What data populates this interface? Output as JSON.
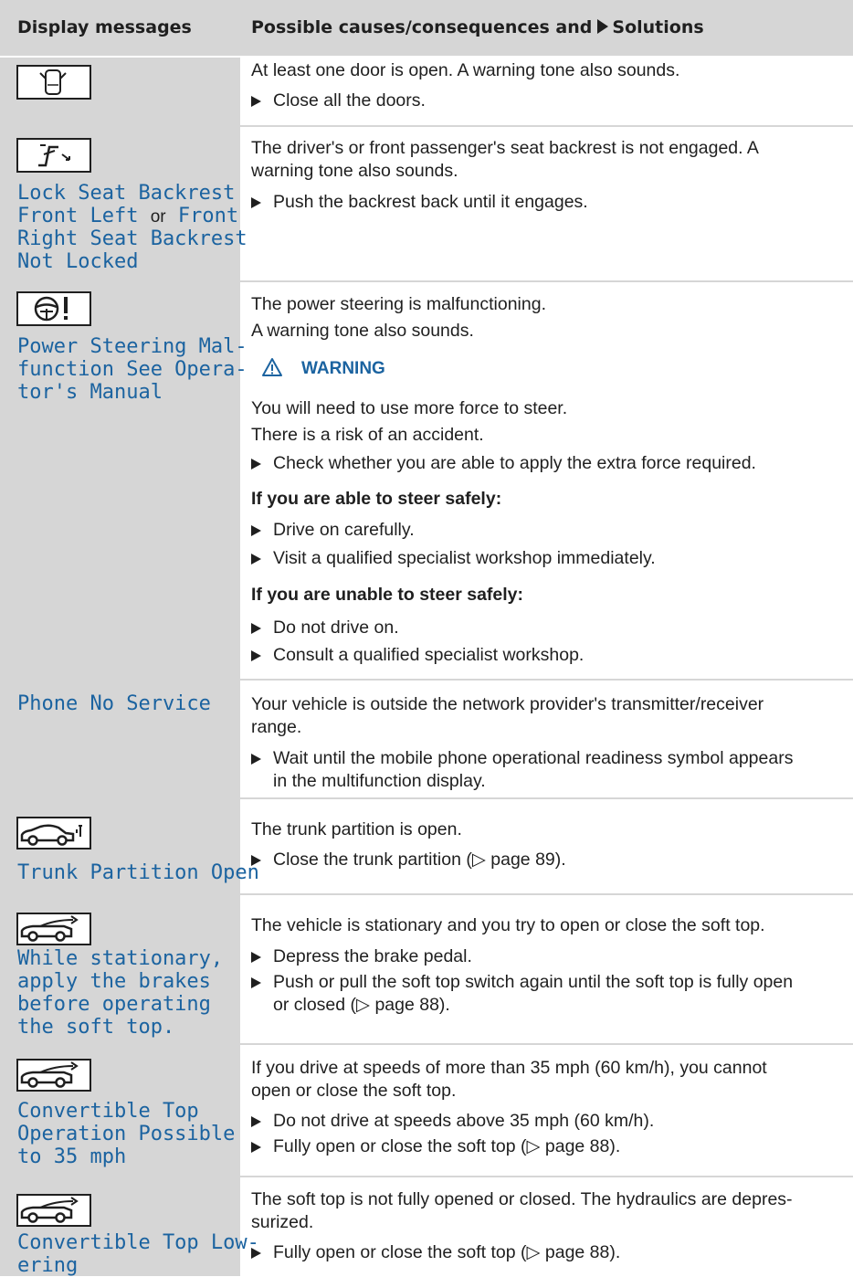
{
  "header": {
    "col1": "Display messages",
    "col2_pre": "Possible causes/consequences and",
    "col2_post": "Solutions"
  },
  "rows": [
    {
      "icon": "door-open-icon",
      "p1": "At least one door is open. A warning tone also sounds.",
      "b1": "Close all the doors."
    },
    {
      "icon": "seat-backrest-icon",
      "d1": "Lock Seat Backrest",
      "d2a": "Front Left",
      "or": "or",
      "d2b": "Front",
      "d3": "Right Seat Backrest",
      "d4": "Not Locked",
      "p1": "The driver's or front passenger's seat backrest is not engaged. A",
      "p2": "warning tone also sounds.",
      "b1": "Push the backrest back until it engages."
    },
    {
      "icon": "steering-wheel-warning-icon",
      "d1": "Power Steering Mal-",
      "d2": "function See Opera-",
      "d3": "tor's Manual",
      "p1": "The power steering is malfunctioning.",
      "p2": "A warning tone also sounds.",
      "warning": "WARNING",
      "w1": "You will need to use more force to steer.",
      "w2": "There is a risk of an accident.",
      "b1": "Check whether you are able to apply the extra force required.",
      "h1": "If you are able to steer safely:",
      "b2": "Drive on carefully.",
      "b3": "Visit a qualified specialist workshop immediately.",
      "h2": "If you are unable to steer safely:",
      "b4": "Do not drive on.",
      "b5": "Consult a qualified specialist workshop."
    },
    {
      "d1": "Phone No Service",
      "p1": "Your vehicle is outside the network provider's transmitter/receiver",
      "p2": "range.",
      "b1a": "Wait until the mobile phone operational readiness symbol appears",
      "b1b": "in the multifunction display."
    },
    {
      "icon": "trunk-partition-icon",
      "d1": "Trunk Partition Open",
      "p1": "The trunk partition is open.",
      "b1": "Close the trunk partition (▷ page 89)."
    },
    {
      "icon": "convertible-icon",
      "d1": "While stationary,",
      "d2": "apply the brakes",
      "d3": "before operating",
      "d4": "the soft top.",
      "p1": "The vehicle is stationary and you try to open or close the soft top.",
      "b1": "Depress the brake pedal.",
      "b2a": "Push or pull the soft top switch again until the soft top is fully open",
      "b2b": "or closed (▷ page 88)."
    },
    {
      "icon": "convertible-icon",
      "d1": "Convertible Top",
      "d2": "Operation Possible",
      "d3": "to 35 mph",
      "p1": "If you drive at speeds of more than 35 mph (60 km/h), you cannot",
      "p2": "open or close the soft top.",
      "b1": "Do not drive at speeds above 35 mph (60 km/h).",
      "b2": "Fully open or close the soft top (▷ page 88)."
    },
    {
      "icon": "convertible-icon",
      "d1": "Convertible Top Low-",
      "d2": "ering",
      "p1": "The soft top is not fully opened or closed. The hydraulics are depres-",
      "p2": "surized.",
      "b1": "Fully open or close the soft top (▷ page 88)."
    }
  ]
}
